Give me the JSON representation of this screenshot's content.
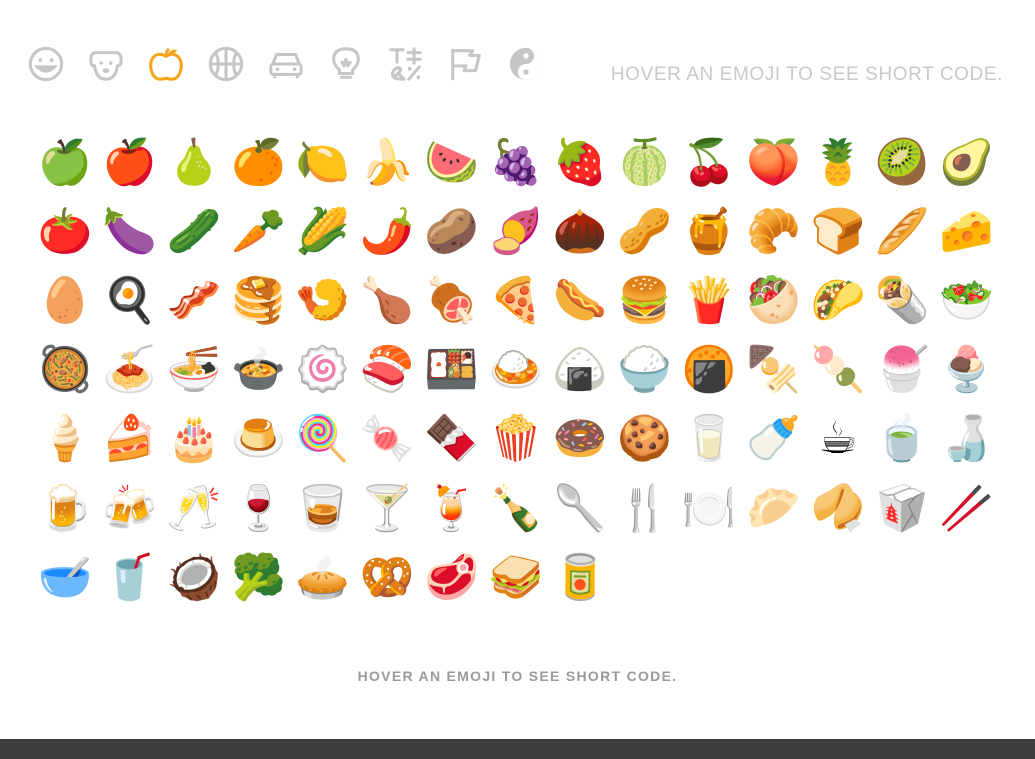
{
  "categories": [
    {
      "id": "people",
      "icon": "smiley-face-icon",
      "active": false
    },
    {
      "id": "nature",
      "icon": "dog-face-icon",
      "active": false
    },
    {
      "id": "food",
      "icon": "apple-icon",
      "active": true
    },
    {
      "id": "activity",
      "icon": "basketball-icon",
      "active": false
    },
    {
      "id": "travel",
      "icon": "car-icon",
      "active": false
    },
    {
      "id": "objects",
      "icon": "lightbulb-icon",
      "active": false
    },
    {
      "id": "symbols",
      "icon": "symbols-icon",
      "active": false
    },
    {
      "id": "flags",
      "icon": "flag-icon",
      "active": false
    },
    {
      "id": "diversity",
      "icon": "yin-yang-icon",
      "active": false
    }
  ],
  "header": {
    "hint": "HOVER AN EMOJI TO SEE SHORT CODE."
  },
  "emojis": [
    {
      "name": "green-apple",
      "char": "🍏"
    },
    {
      "name": "red-apple",
      "char": "🍎"
    },
    {
      "name": "pear",
      "char": "🍐"
    },
    {
      "name": "tangerine",
      "char": "🍊"
    },
    {
      "name": "lemon",
      "char": "🍋"
    },
    {
      "name": "banana",
      "char": "🍌"
    },
    {
      "name": "watermelon",
      "char": "🍉"
    },
    {
      "name": "grapes",
      "char": "🍇"
    },
    {
      "name": "strawberry",
      "char": "🍓"
    },
    {
      "name": "melon",
      "char": "🍈"
    },
    {
      "name": "cherries",
      "char": "🍒"
    },
    {
      "name": "peach",
      "char": "🍑"
    },
    {
      "name": "pineapple",
      "char": "🍍"
    },
    {
      "name": "kiwi",
      "char": "🥝"
    },
    {
      "name": "avocado",
      "char": "🥑"
    },
    {
      "name": "tomato",
      "char": "🍅"
    },
    {
      "name": "eggplant",
      "char": "🍆"
    },
    {
      "name": "cucumber",
      "char": "🥒"
    },
    {
      "name": "carrot",
      "char": "🥕"
    },
    {
      "name": "corn",
      "char": "🌽"
    },
    {
      "name": "hot-pepper",
      "char": "🌶️"
    },
    {
      "name": "potato",
      "char": "🥔"
    },
    {
      "name": "sweet-potato",
      "char": "🍠"
    },
    {
      "name": "chestnut",
      "char": "🌰"
    },
    {
      "name": "peanuts",
      "char": "🥜"
    },
    {
      "name": "honey-pot",
      "char": "🍯"
    },
    {
      "name": "croissant",
      "char": "🥐"
    },
    {
      "name": "bread",
      "char": "🍞"
    },
    {
      "name": "baguette",
      "char": "🥖"
    },
    {
      "name": "cheese",
      "char": "🧀"
    },
    {
      "name": "egg",
      "char": "🥚"
    },
    {
      "name": "cooking",
      "char": "🍳"
    },
    {
      "name": "bacon",
      "char": "🥓"
    },
    {
      "name": "pancakes",
      "char": "🥞"
    },
    {
      "name": "fried-shrimp",
      "char": "🍤"
    },
    {
      "name": "poultry-leg",
      "char": "🍗"
    },
    {
      "name": "meat-on-bone",
      "char": "🍖"
    },
    {
      "name": "pizza",
      "char": "🍕"
    },
    {
      "name": "hot-dog",
      "char": "🌭"
    },
    {
      "name": "hamburger",
      "char": "🍔"
    },
    {
      "name": "fries",
      "char": "🍟"
    },
    {
      "name": "stuffed-flatbread",
      "char": "🥙"
    },
    {
      "name": "taco",
      "char": "🌮"
    },
    {
      "name": "burrito",
      "char": "🌯"
    },
    {
      "name": "green-salad",
      "char": "🥗"
    },
    {
      "name": "shallow-pan-of-food",
      "char": "🥘"
    },
    {
      "name": "spaghetti",
      "char": "🍝"
    },
    {
      "name": "ramen",
      "char": "🍜"
    },
    {
      "name": "stew",
      "char": "🍲"
    },
    {
      "name": "fish-cake",
      "char": "🍥"
    },
    {
      "name": "sushi",
      "char": "🍣"
    },
    {
      "name": "bento",
      "char": "🍱"
    },
    {
      "name": "curry",
      "char": "🍛"
    },
    {
      "name": "rice-ball",
      "char": "🍙"
    },
    {
      "name": "rice",
      "char": "🍚"
    },
    {
      "name": "rice-cracker",
      "char": "🍘"
    },
    {
      "name": "oden",
      "char": "🍢"
    },
    {
      "name": "dango",
      "char": "🍡"
    },
    {
      "name": "shaved-ice",
      "char": "🍧"
    },
    {
      "name": "ice-cream",
      "char": "🍨"
    },
    {
      "name": "icecream",
      "char": "🍦"
    },
    {
      "name": "shortcake",
      "char": "🍰"
    },
    {
      "name": "birthday",
      "char": "🎂"
    },
    {
      "name": "custard",
      "char": "🍮"
    },
    {
      "name": "lollipop",
      "char": "🍭"
    },
    {
      "name": "candy",
      "char": "🍬"
    },
    {
      "name": "chocolate-bar",
      "char": "🍫"
    },
    {
      "name": "popcorn",
      "char": "🍿"
    },
    {
      "name": "doughnut",
      "char": "🍩"
    },
    {
      "name": "cookie",
      "char": "🍪"
    },
    {
      "name": "milk",
      "char": "🥛"
    },
    {
      "name": "baby-bottle",
      "char": "🍼"
    },
    {
      "name": "coffee",
      "char": "☕"
    },
    {
      "name": "tea",
      "char": "🍵"
    },
    {
      "name": "sake",
      "char": "🍶"
    },
    {
      "name": "beer",
      "char": "🍺"
    },
    {
      "name": "beers",
      "char": "🍻"
    },
    {
      "name": "champagne-glass",
      "char": "🥂"
    },
    {
      "name": "wine-glass",
      "char": "🍷"
    },
    {
      "name": "tumbler-glass",
      "char": "🥃"
    },
    {
      "name": "cocktail",
      "char": "🍸"
    },
    {
      "name": "tropical-drink",
      "char": "🍹"
    },
    {
      "name": "champagne",
      "char": "🍾"
    },
    {
      "name": "spoon",
      "char": "🥄"
    },
    {
      "name": "fork-and-knife",
      "char": "🍴"
    },
    {
      "name": "fork-knife-plate",
      "char": "🍽️"
    },
    {
      "name": "dumpling",
      "char": "🥟"
    },
    {
      "name": "fortune-cookie",
      "char": "🥠"
    },
    {
      "name": "takeout-box",
      "char": "🥡"
    },
    {
      "name": "chopsticks",
      "char": "🥢"
    },
    {
      "name": "bowl-with-spoon",
      "char": "🥣"
    },
    {
      "name": "cup-with-straw",
      "char": "🥤"
    },
    {
      "name": "coconut",
      "char": "🥥"
    },
    {
      "name": "broccoli",
      "char": "🥦"
    },
    {
      "name": "pie",
      "char": "🥧"
    },
    {
      "name": "pretzel",
      "char": "🥨"
    },
    {
      "name": "cut-of-meat",
      "char": "🥩"
    },
    {
      "name": "sandwich",
      "char": "🥪"
    },
    {
      "name": "canned-food",
      "char": "🥫"
    }
  ],
  "footer": {
    "hint": "HOVER AN EMOJI TO SEE SHORT CODE."
  }
}
